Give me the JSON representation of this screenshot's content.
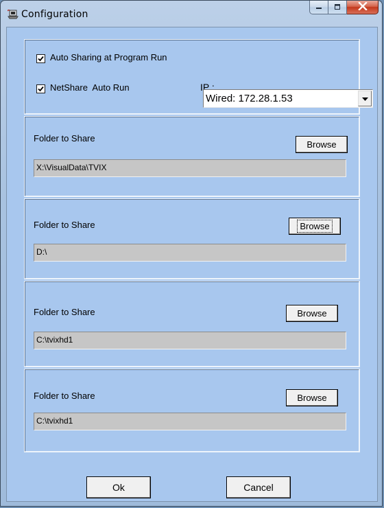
{
  "window": {
    "title": "Configuration",
    "icons": {
      "app": "network-share-icon",
      "minimize": "minimize-icon",
      "maximize": "maximize-icon",
      "close": "close-icon"
    }
  },
  "options": {
    "auto_sharing_label": "Auto Sharing at Program Run",
    "auto_sharing_checked": true,
    "netshare_label": "NetShare  Auto Run",
    "netshare_checked": true,
    "ip_label": "IP :",
    "ip_value": "Wired: 172.28.1.53"
  },
  "folders": [
    {
      "label": "Folder to Share",
      "path": "X:\\VisualData\\TVIX",
      "browse": "Browse"
    },
    {
      "label": "Folder to Share",
      "path": "D:\\",
      "browse": "Browse"
    },
    {
      "label": "Folder to Share",
      "path": "C:\\tvixhd1",
      "browse": "Browse"
    },
    {
      "label": "Folder to Share",
      "path": "C:\\tvixhd1",
      "browse": "Browse"
    }
  ],
  "footer": {
    "ok_label": "Ok",
    "cancel_label": "Cancel"
  },
  "colors": {
    "client_bg": "#a8c7ee",
    "field_bg": "#c6c6c6",
    "close_red": "#c3381c"
  }
}
